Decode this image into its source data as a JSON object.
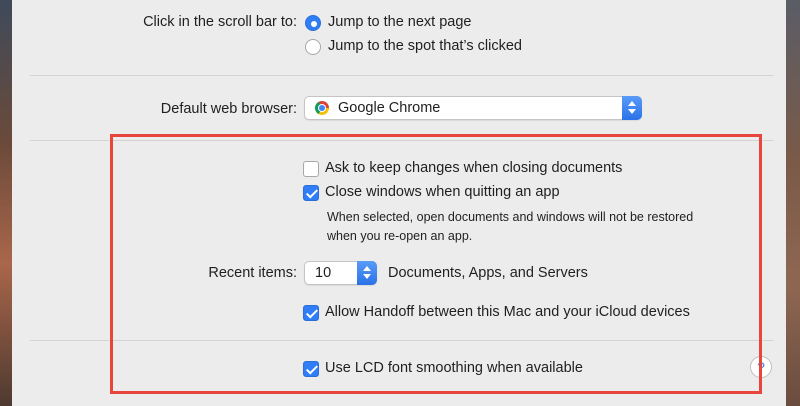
{
  "scroll_bar": {
    "label": "Click in the scroll bar to:",
    "options": [
      "Jump to the next page",
      "Jump to the spot that’s clicked"
    ],
    "selected_index": 0
  },
  "browser": {
    "label": "Default web browser:",
    "value": "Google Chrome",
    "icon": "chrome-icon"
  },
  "documents": {
    "ask_keep_changes": {
      "label": "Ask to keep changes when closing documents",
      "checked": false
    },
    "close_windows": {
      "label": "Close windows when quitting an app",
      "checked": true
    },
    "note_line1": "When selected, open documents and windows will not be restored",
    "note_line2": "when you re-open an app."
  },
  "recent_items": {
    "label": "Recent items:",
    "value": "10",
    "suffix": "Documents, Apps, and Servers"
  },
  "handoff": {
    "label": "Allow Handoff between this Mac and your iCloud devices",
    "checked": true
  },
  "lcd": {
    "label": "Use LCD font smoothing when available",
    "checked": true
  },
  "help": {
    "glyph": "?"
  },
  "colors": {
    "accent": "#2f7ef5",
    "highlight": "#e8453c",
    "window_bg": "#ececec"
  }
}
